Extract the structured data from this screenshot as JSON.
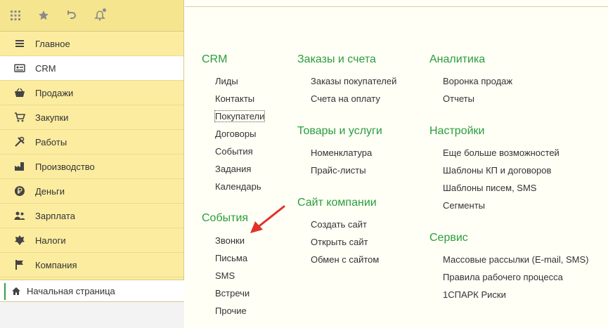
{
  "sidebar": {
    "items": [
      {
        "label": "Главное",
        "icon": "menu-lines-icon"
      },
      {
        "label": "CRM",
        "icon": "crm-card-icon"
      },
      {
        "label": "Продажи",
        "icon": "basket-icon"
      },
      {
        "label": "Закупки",
        "icon": "cart-icon"
      },
      {
        "label": "Работы",
        "icon": "tools-icon"
      },
      {
        "label": "Производство",
        "icon": "factory-icon"
      },
      {
        "label": "Деньги",
        "icon": "ruble-coin-icon"
      },
      {
        "label": "Зарплата",
        "icon": "people-icon"
      },
      {
        "label": "Налоги",
        "icon": "emblem-icon"
      },
      {
        "label": "Компания",
        "icon": "flag-icon"
      }
    ],
    "home_label": "Начальная страница"
  },
  "sections": {
    "crm": {
      "title": "CRM",
      "links": [
        "Лиды",
        "Контакты",
        "Покупатели",
        "Договоры",
        "События",
        "Задания",
        "Календарь"
      ]
    },
    "events": {
      "title": "События",
      "links": [
        "Звонки",
        "Письма",
        "SMS",
        "Встречи",
        "Прочие"
      ]
    },
    "orders": {
      "title": "Заказы и счета",
      "links": [
        "Заказы покупателей",
        "Счета на оплату"
      ]
    },
    "goods": {
      "title": "Товары и услуги",
      "links": [
        "Номенклатура",
        "Прайс-листы"
      ]
    },
    "site": {
      "title": "Сайт компании",
      "links": [
        "Создать сайт",
        "Открыть сайт",
        "Обмен с сайтом"
      ]
    },
    "analytics": {
      "title": "Аналитика",
      "links": [
        "Воронка продаж",
        "Отчеты"
      ]
    },
    "settings": {
      "title": "Настройки",
      "links": [
        "Еще больше возможностей",
        "Шаблоны КП и договоров",
        "Шаблоны писем, SMS",
        "Сегменты"
      ]
    },
    "service": {
      "title": "Сервис",
      "links": [
        "Массовые рассылки (E-mail, SMS)",
        "Правила рабочего процесса",
        "1СПАРК Риски"
      ]
    }
  },
  "colors": {
    "sidebar_bg": "#fbeca0",
    "section_title": "#2a9d3d",
    "arrow": "#e0322b"
  }
}
